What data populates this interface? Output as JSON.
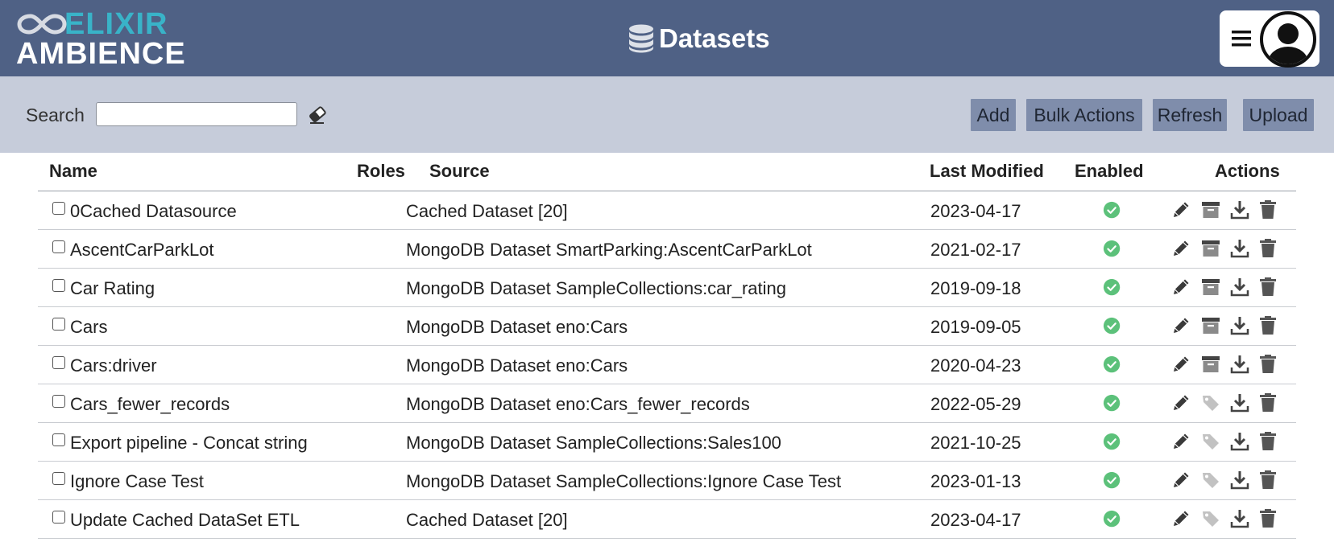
{
  "header": {
    "logo_line1": "ELIXIR",
    "logo_line2": "AMBIENCE",
    "title": "Datasets",
    "title_icon": "database-icon",
    "menu_icon": "hamburger-menu-icon",
    "avatar_icon": "user-avatar-icon",
    "brand_color": "#39b3c8",
    "header_color": "#4f6185"
  },
  "toolbar": {
    "search_label": "Search",
    "search_value": "",
    "search_placeholder": "",
    "clear_icon": "eraser-icon",
    "buttons": {
      "add": "Add",
      "bulk": "Bulk Actions",
      "refresh": "Refresh",
      "upload": "Upload"
    }
  },
  "table": {
    "columns": {
      "name": "Name",
      "roles": "Roles",
      "source": "Source",
      "modified": "Last Modified",
      "enabled": "Enabled",
      "actions": "Actions"
    },
    "rows": [
      {
        "name": "0Cached Datasource",
        "roles": "",
        "source": "Cached Dataset [20]",
        "modified": "2023-04-17",
        "enabled": true,
        "second_action": "archive-icon"
      },
      {
        "name": "AscentCarParkLot",
        "roles": "",
        "source": "MongoDB Dataset SmartParking:AscentCarParkLot",
        "modified": "2021-02-17",
        "enabled": true,
        "second_action": "archive-icon"
      },
      {
        "name": "Car Rating",
        "roles": "",
        "source": "MongoDB Dataset SampleCollections:car_rating",
        "modified": "2019-09-18",
        "enabled": true,
        "second_action": "archive-icon"
      },
      {
        "name": "Cars",
        "roles": "",
        "source": "MongoDB Dataset eno:Cars",
        "modified": "2019-09-05",
        "enabled": true,
        "second_action": "archive-icon"
      },
      {
        "name": "Cars:driver",
        "roles": "",
        "source": "MongoDB Dataset eno:Cars",
        "modified": "2020-04-23",
        "enabled": true,
        "second_action": "archive-icon"
      },
      {
        "name": "Cars_fewer_records",
        "roles": "",
        "source": "MongoDB Dataset eno:Cars_fewer_records",
        "modified": "2022-05-29",
        "enabled": true,
        "second_action": "tag-icon"
      },
      {
        "name": "Export pipeline - Concat string",
        "roles": "",
        "source": "MongoDB Dataset SampleCollections:Sales100",
        "modified": "2021-10-25",
        "enabled": true,
        "second_action": "tag-icon"
      },
      {
        "name": "Ignore Case Test",
        "roles": "",
        "source": "MongoDB Dataset SampleCollections:Ignore Case Test",
        "modified": "2023-01-13",
        "enabled": true,
        "second_action": "tag-icon"
      },
      {
        "name": "Update Cached DataSet ETL",
        "roles": "",
        "source": "Cached Dataset [20]",
        "modified": "2023-04-17",
        "enabled": true,
        "second_action": "tag-icon"
      }
    ]
  }
}
